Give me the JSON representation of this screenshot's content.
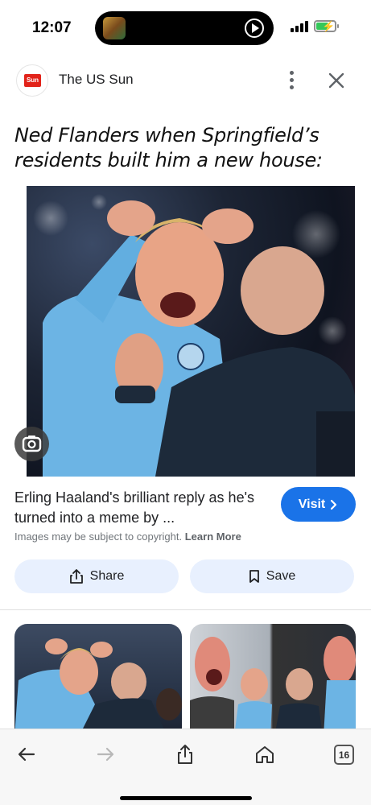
{
  "status_bar": {
    "time": "12:07",
    "battery_percent": 70,
    "battery_color": "#34c759",
    "signal_bars": 4
  },
  "header": {
    "source_logo_text": "Sun",
    "source_name": "The US Sun",
    "more_icon": "more-vert-icon",
    "close_icon": "close-icon"
  },
  "caption": "Ned Flanders when Springfield’s residents built him a new house:",
  "main_image": {
    "lens_icon": "camera-lens-icon"
  },
  "result": {
    "title": "Erling Haaland's brilliant reply as he's turned into a meme by ...",
    "visit_label": "Visit",
    "visit_icon": "chevron-right-icon",
    "copyright_text": "Images may be subject to copyright.",
    "learn_more": "Learn More"
  },
  "actions": {
    "share_label": "Share",
    "share_icon": "share-icon",
    "save_label": "Save",
    "save_icon": "bookmark-icon"
  },
  "toolbar": {
    "back_icon": "back-arrow-icon",
    "forward_icon": "forward-arrow-icon",
    "share_icon": "share-icon",
    "home_icon": "home-icon",
    "tab_count": "16"
  },
  "colors": {
    "accent": "#1a73e8",
    "action_bg": "#e8f0fe",
    "brand_red": "#e2231a"
  }
}
